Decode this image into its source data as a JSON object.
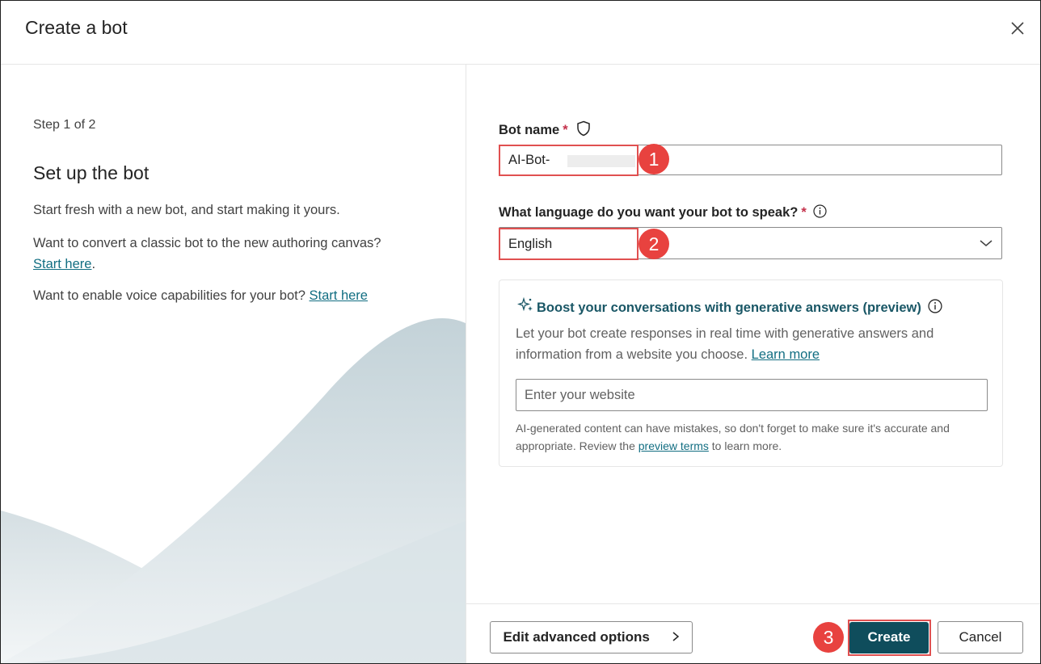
{
  "dialog": {
    "title": "Create a bot",
    "close_icon": "close-icon"
  },
  "left_panel": {
    "step": "Step 1 of 2",
    "heading": "Set up the bot",
    "intro": "Start fresh with a new bot, and start making it yours.",
    "convert_text": "Want to convert a classic bot to the new authoring canvas?",
    "convert_link": "Start here",
    "convert_suffix": ".",
    "voice_text": "Want to enable voice capabilities for your bot?",
    "voice_link": "Start here"
  },
  "form": {
    "bot_name_label": "Bot name",
    "required_mark": "*",
    "bot_name_value": "AI-Bot-",
    "language_label": "What language do you want your bot to speak?",
    "language_value": "English",
    "icons": {
      "shield": "shield-icon",
      "info": "info-icon",
      "chevron": "chevron-down-icon",
      "sparkle": "sparkle-icon"
    }
  },
  "generative": {
    "title": "Boost your conversations with generative answers (preview)",
    "desc": "Let your bot create responses in real time with generative answers and information from a website you choose.",
    "learn_more": "Learn more",
    "website_placeholder": "Enter your website",
    "note_text": "AI-generated content can have mistakes, so don't forget to make sure it's accurate and appropriate. Review the",
    "note_link": "preview terms",
    "note_suffix": "to learn more."
  },
  "footer": {
    "advanced_label": "Edit advanced options",
    "create_label": "Create",
    "cancel_label": "Cancel"
  },
  "annotations": {
    "one": "1",
    "two": "2",
    "three": "3",
    "color": "#e8423f"
  },
  "colors": {
    "primary": "#0f4d5c",
    "link": "#126e82",
    "required": "#c4314b"
  }
}
